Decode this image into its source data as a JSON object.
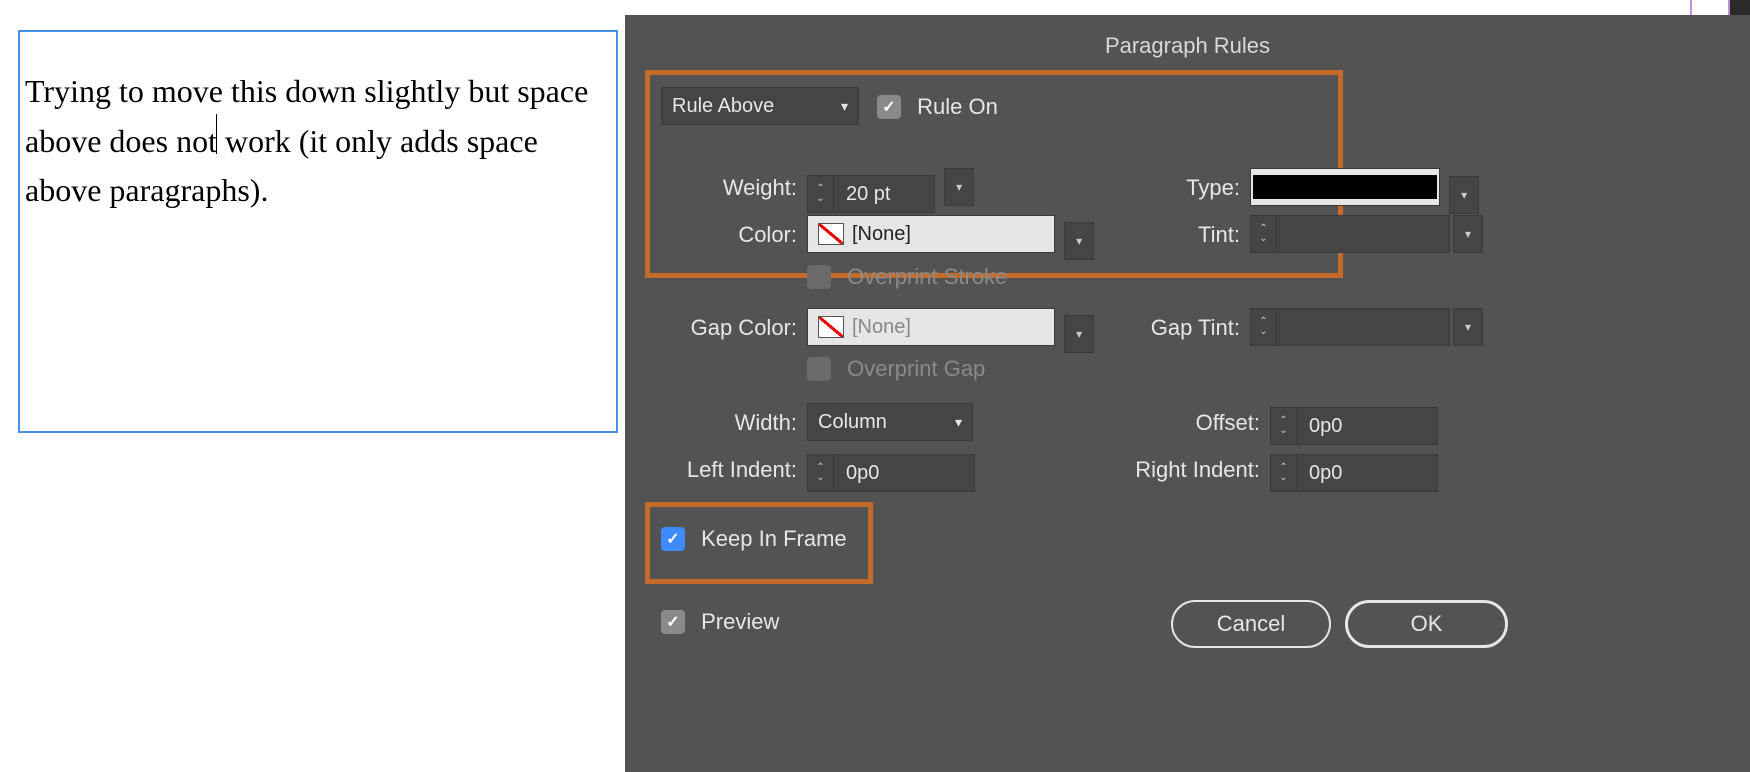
{
  "textFrame": {
    "content": "Trying to move this down slightly but space above does not work (it only adds space above para­graphs)."
  },
  "dialog": {
    "title": "Paragraph Rules",
    "ruleSelect": "Rule Above",
    "ruleOn": {
      "label": "Rule On",
      "checked": true
    },
    "weight": {
      "label": "Weight:",
      "value": "20 pt"
    },
    "type": {
      "label": "Type:"
    },
    "color": {
      "label": "Color:",
      "value": "[None]"
    },
    "tint": {
      "label": "Tint:",
      "value": ""
    },
    "overprintStroke": {
      "label": "Overprint Stroke",
      "checked": false
    },
    "gapColor": {
      "label": "Gap Color:",
      "value": "[None]"
    },
    "gapTint": {
      "label": "Gap Tint:",
      "value": ""
    },
    "overprintGap": {
      "label": "Overprint Gap",
      "checked": false
    },
    "width": {
      "label": "Width:",
      "value": "Column"
    },
    "offset": {
      "label": "Offset:",
      "value": "0p0"
    },
    "leftIndent": {
      "label": "Left Indent:",
      "value": "0p0"
    },
    "rightIndent": {
      "label": "Right Indent:",
      "value": "0p0"
    },
    "keepInFrame": {
      "label": "Keep In Frame",
      "checked": true
    },
    "preview": {
      "label": "Preview",
      "checked": true
    },
    "cancel": "Cancel",
    "ok": "OK"
  }
}
